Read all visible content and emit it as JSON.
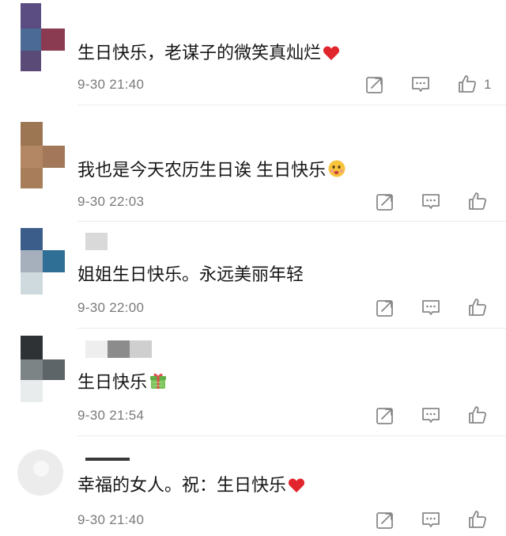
{
  "comments": [
    {
      "text": "生日快乐，老谋子的微笑真灿烂",
      "emoji": "heart-emoji",
      "time": "9-30 21:40",
      "likes": "1",
      "avatar_colors": [
        "#5b4d82",
        "#4b6a95",
        "#8a3b52",
        "#5a4a78"
      ]
    },
    {
      "text": "我也是今天农历生日诶 生日快乐",
      "emoji": "face-emoji",
      "time": "9-30 22:03",
      "likes": "",
      "avatar_colors": [
        "#9c7552",
        "#b38763",
        "#a77e59"
      ]
    },
    {
      "text": "姐姐生日快乐。永远美丽年轻",
      "emoji": "",
      "time": "9-30 22:00",
      "likes": "",
      "avatar_colors": [
        "#3a5d8a",
        "#a6b0bc",
        "#2f6f95",
        "#cfdadf"
      ]
    },
    {
      "text": "生日快乐",
      "emoji": "gift-emoji",
      "time": "9-30 21:54",
      "likes": "",
      "avatar_colors": [
        "#2e3235",
        "#7d8486",
        "#5d6568",
        "#e9eced"
      ]
    },
    {
      "text": "幸福的女人。祝：生日快乐",
      "emoji": "heart-emoji",
      "time": "9-30 21:40",
      "likes": "",
      "avatar_colors": [
        "#e6e6e6",
        "#f0f0f0"
      ]
    }
  ],
  "icons": {
    "share": "share-icon",
    "comment": "comment-icon",
    "like": "thumbs-up-icon"
  },
  "colors": {
    "text": "#161616",
    "meta": "#7a7a7a",
    "heart": "#e0252d"
  }
}
